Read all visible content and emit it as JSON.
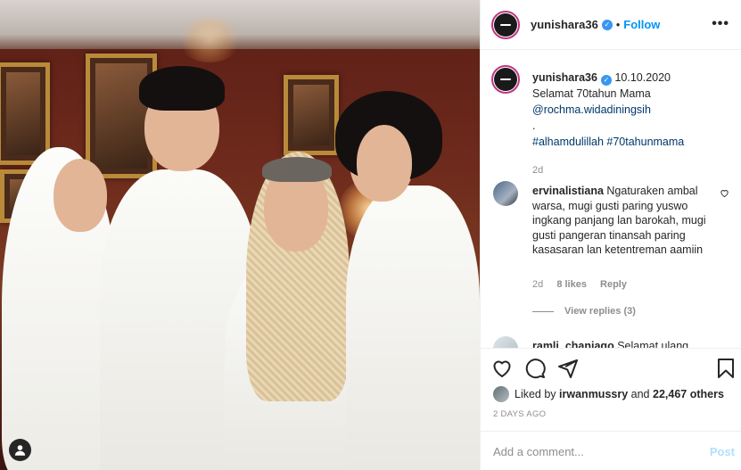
{
  "post": {
    "username": "yunishara36",
    "separator": "•",
    "follow_label": "Follow",
    "more_label": "•••",
    "verified_mark": "✓"
  },
  "caption": {
    "username": "yunishara36",
    "date": "10.10.2020",
    "line1": "Selamat 70tahun Mama",
    "mention": "@rochma.widadiningsih",
    "dot": ".",
    "hashtags": "#alhamdulillah #70tahunmama",
    "time": "2d"
  },
  "comments": [
    {
      "username": "ervinalistiana",
      "text": "Ngaturaken ambal warsa, mugi gusti paring yuswo ingkang panjang lan barokah, mugi gusti pangeran tinansah paring kasasaran lan ketentreman aamiin",
      "time": "2d",
      "likes": "8 likes",
      "reply_label": "Reply",
      "view_replies": "View replies (3)"
    },
    {
      "username": "ramli_chaniago",
      "text": "Selamat ulang"
    }
  ],
  "actions": {
    "like_icon": "heart-icon",
    "comment_icon": "comment-icon",
    "share_icon": "share-icon",
    "save_icon": "bookmark-icon"
  },
  "likes": {
    "prefix": "Liked by",
    "user": "irwanmussry",
    "middle": "and",
    "others": "22,467 others"
  },
  "date_label": "2 DAYS AGO",
  "add_comment": {
    "placeholder": "Add a comment...",
    "post_label": "Post"
  },
  "colors": {
    "link": "#0095f6",
    "tag": "#00376b",
    "muted": "#8e8e8e",
    "post_disabled": "#b2dffc"
  }
}
